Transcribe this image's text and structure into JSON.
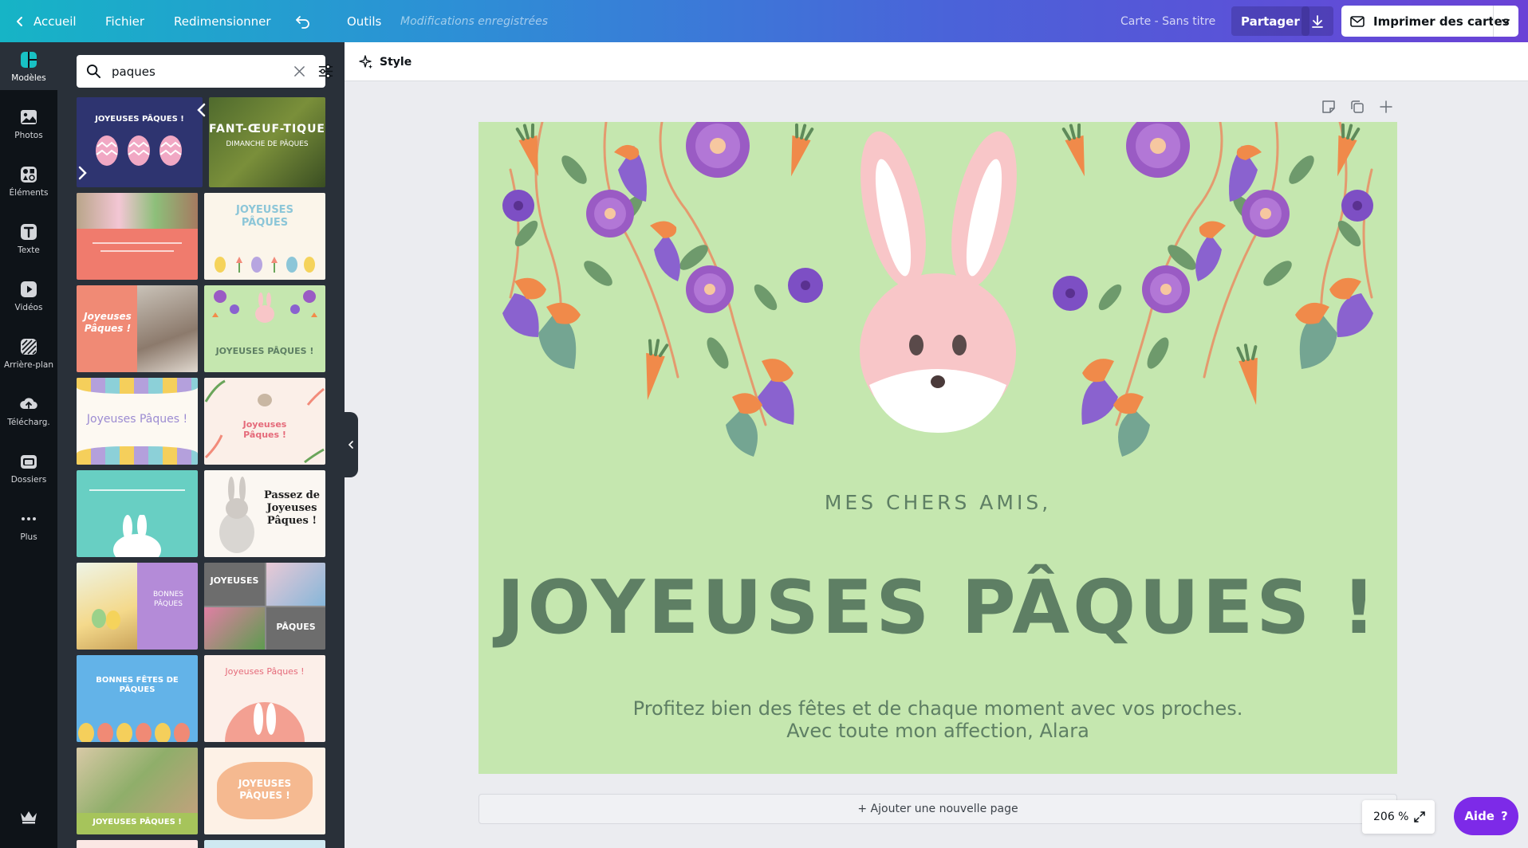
{
  "topbar": {
    "back_label": "Accueil",
    "file_label": "Fichier",
    "resize_label": "Redimensionner",
    "tools_label": "Outils",
    "saved_status": "Modifications enregistrées",
    "doc_title": "Carte - Sans titre",
    "share_label": "Partager",
    "print_label": "Imprimer des cartes"
  },
  "rail": {
    "items": [
      {
        "label": "Modèles",
        "icon": "templates-icon"
      },
      {
        "label": "Photos",
        "icon": "photos-icon"
      },
      {
        "label": "Éléments",
        "icon": "elements-icon"
      },
      {
        "label": "Texte",
        "icon": "text-icon"
      },
      {
        "label": "Vidéos",
        "icon": "videos-icon"
      },
      {
        "label": "Arrière-plan",
        "icon": "background-icon"
      },
      {
        "label": "Télécharg.",
        "icon": "upload-icon"
      },
      {
        "label": "Dossiers",
        "icon": "folders-icon"
      },
      {
        "label": "Plus",
        "icon": "more-icon"
      }
    ]
  },
  "search": {
    "value": "paques"
  },
  "templates": [
    {
      "title": "JOYEUSES PÂQUES !"
    },
    {
      "title": "FANT-ŒUF-TIQUE"
    },
    {
      "title": "DIMANCHE DE PÂQUES"
    },
    {
      "title": "JOYEUSES PÂQUES"
    },
    {
      "title": "Joyeuses Pâques !"
    },
    {
      "title": "JOYEUSES PÂQUES !"
    },
    {
      "title": "Joyeuses Pâques !"
    },
    {
      "title": "Joyeuses Pâques !"
    },
    {
      "title": "Passez de Joyeuses Pâques !"
    },
    {
      "title": "BONNES PÂQUES"
    },
    {
      "title": "JOYEUSES"
    },
    {
      "title": "PÂQUES"
    },
    {
      "title": "BONNES FÊTES DE PÂQUES"
    },
    {
      "title": "Joyeuses Pâques !"
    },
    {
      "title": "JOYEUSES PÂQUES !"
    },
    {
      "title": "JOYEUSES PÂQUES !"
    }
  ],
  "editor": {
    "style_label": "Style",
    "greeting": "MES CHERS AMIS,",
    "title": "JOYEUSES PÂQUES !",
    "body_line1": "Profitez bien des fêtes et de chaque moment avec vos proches.",
    "body_line2": "Avec toute mon affection, Alara",
    "add_page_label": "+ Ajouter une nouvelle page",
    "zoom": "206 %",
    "help_label": "Aide",
    "help_glyph": "?"
  },
  "colors": {
    "canvas_bg": "#c5e7af",
    "title_text": "#5e7f64",
    "accent_purple": "#7d2ae8",
    "panel_bg": "#293039",
    "rail_bg": "#0e1318"
  }
}
